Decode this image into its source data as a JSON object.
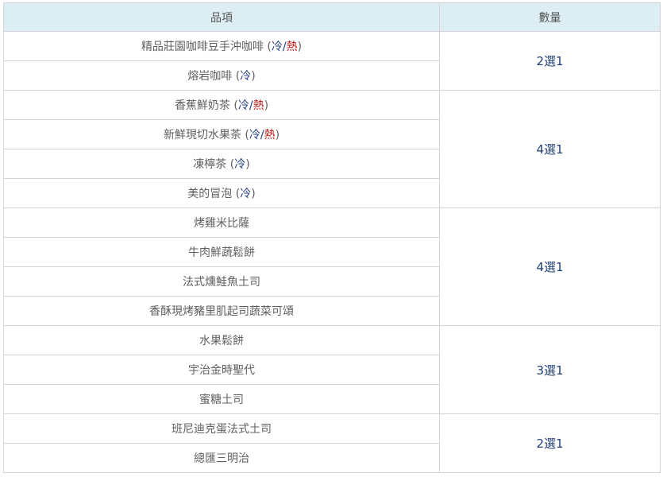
{
  "headers": {
    "item": "品項",
    "qty": "數量"
  },
  "groups": [
    {
      "qty": "2選1",
      "items": [
        {
          "name": "精品莊園咖啡豆手沖咖啡",
          "temp": "both"
        },
        {
          "name": "熔岩咖啡",
          "temp": "cold"
        }
      ]
    },
    {
      "qty": "4選1",
      "items": [
        {
          "name": "香蕉鮮奶茶",
          "temp": "both"
        },
        {
          "name": "新鮮現切水果茶",
          "temp": "both"
        },
        {
          "name": "凍檸茶",
          "temp": "cold"
        },
        {
          "name": "美的冒泡",
          "temp": "cold"
        }
      ]
    },
    {
      "qty": "4選1",
      "items": [
        {
          "name": "烤雞米比薩",
          "temp": ""
        },
        {
          "name": "牛肉鮮蔬鬆餅",
          "temp": ""
        },
        {
          "name": "法式燻鮭魚土司",
          "temp": ""
        },
        {
          "name": "香酥現烤豬里肌起司蔬菜可頌",
          "temp": ""
        }
      ]
    },
    {
      "qty": "3選1",
      "items": [
        {
          "name": "水果鬆餅",
          "temp": ""
        },
        {
          "name": "宇治金時聖代",
          "temp": ""
        },
        {
          "name": "蜜糖土司",
          "temp": ""
        }
      ]
    },
    {
      "qty": "2選1",
      "items": [
        {
          "name": "班尼迪克蛋法式土司",
          "temp": ""
        },
        {
          "name": "總匯三明治",
          "temp": ""
        }
      ]
    }
  ],
  "temp_labels": {
    "cold": "冷",
    "hot": "熱"
  },
  "colors": {
    "header_bg": "#dceef4",
    "border": "#d4d4d4",
    "cold": "#233e84",
    "hot": "#c01818",
    "qty": "#1f3d74"
  }
}
